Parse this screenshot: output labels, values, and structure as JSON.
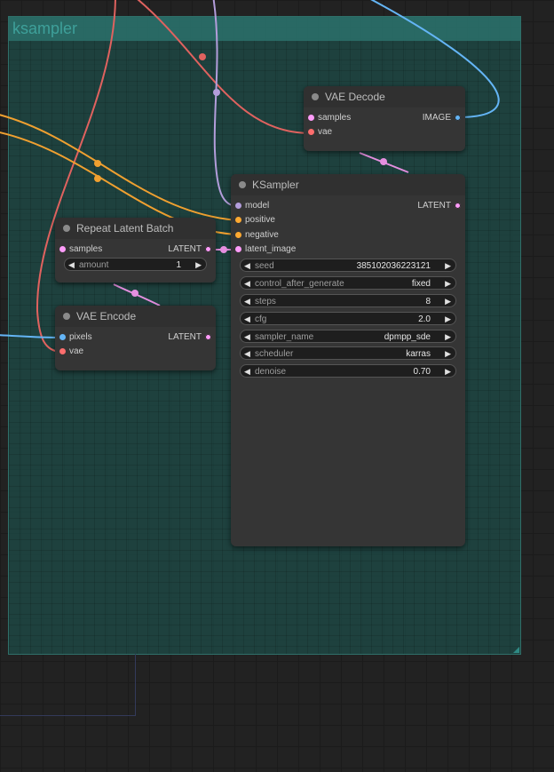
{
  "group": {
    "title": "ksampler"
  },
  "colors": {
    "model": "#b39ddb",
    "conditioning": "#ffa931",
    "latent": "#ff9cf9",
    "vae": "#ff6e6e",
    "image": "#64b5f6"
  },
  "nodes": {
    "vae_decode": {
      "title": "VAE Decode",
      "inputs": [
        "samples",
        "vae"
      ],
      "output": "IMAGE"
    },
    "ksampler": {
      "title": "KSampler",
      "inputs": [
        "model",
        "positive",
        "negative",
        "latent_image"
      ],
      "output": "LATENT",
      "widgets": [
        {
          "label": "seed",
          "value": "385102036223121"
        },
        {
          "label": "control_after_generate",
          "value": "fixed"
        },
        {
          "label": "steps",
          "value": "8"
        },
        {
          "label": "cfg",
          "value": "2.0"
        },
        {
          "label": "sampler_name",
          "value": "dpmpp_sde"
        },
        {
          "label": "scheduler",
          "value": "karras"
        },
        {
          "label": "denoise",
          "value": "0.70"
        }
      ]
    },
    "repeat_latent_batch": {
      "title": "Repeat Latent Batch",
      "inputs": [
        "samples"
      ],
      "output": "LATENT",
      "widgets": [
        {
          "label": "amount",
          "value": "1"
        }
      ]
    },
    "vae_encode": {
      "title": "VAE Encode",
      "inputs": [
        "pixels",
        "vae"
      ],
      "output": "LATENT"
    }
  }
}
